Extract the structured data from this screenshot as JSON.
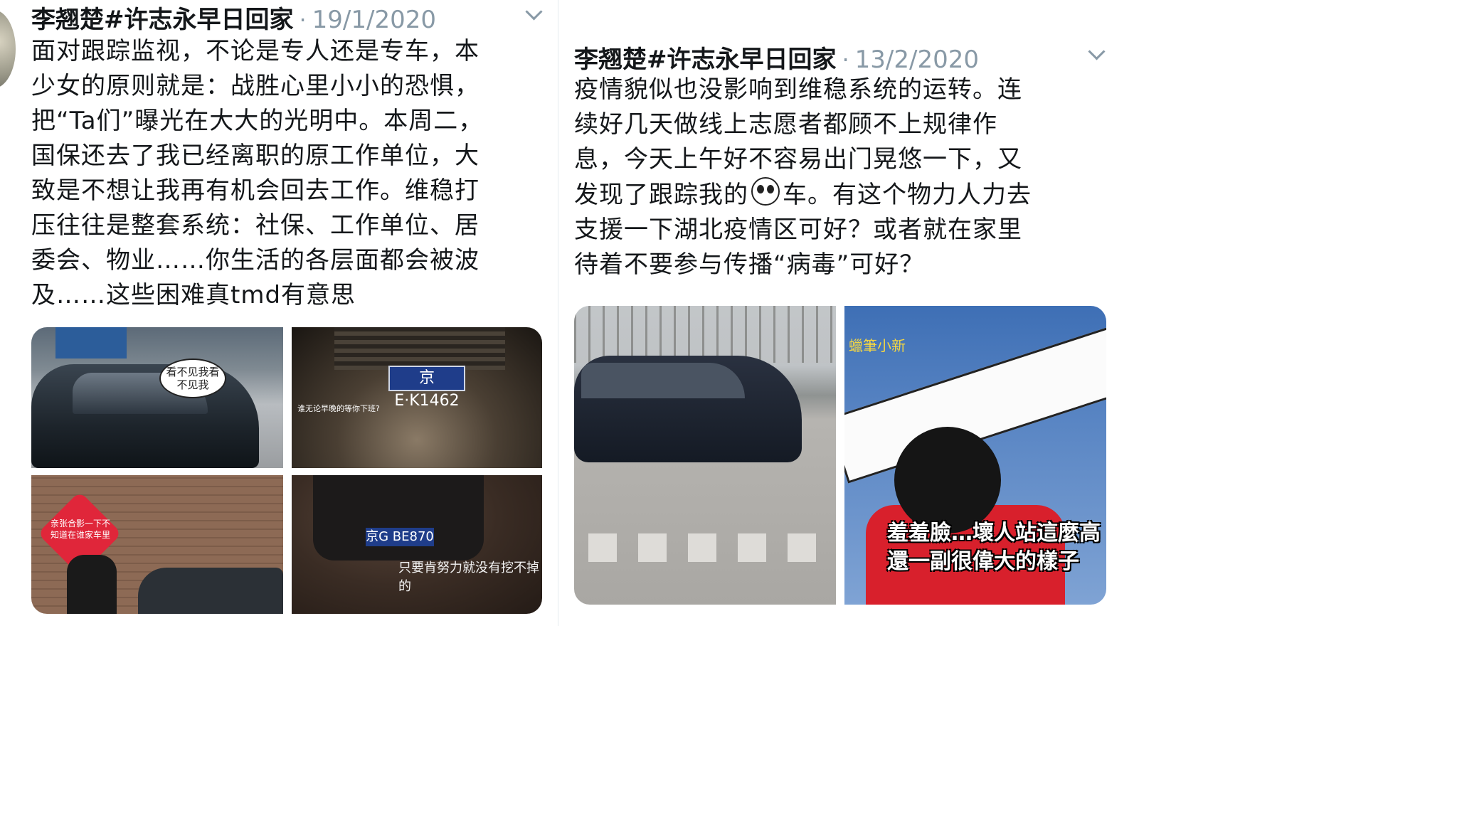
{
  "tweets": [
    {
      "name": "李翘楚#许志永早日回家",
      "separator": "·",
      "date": "19/1/2020",
      "text_lines": [
        "面对跟踪监视，不论是专人还是专车，本",
        "少女的原则就是：战胜心里小小的恐惧，",
        "把“Ta们”曝光在大大的光明中。本周二，",
        "国保还去了我已经离职的原工作单位，大",
        "致是不想让我再有机会回去工作。维稳打",
        "压往往是整套系统：社保、工作单位、居",
        "委会、物业……你生活的各层面都会被波",
        "及……这些困难真tmd有意思"
      ],
      "photos": {
        "p1_bubble": "看不见我看不见我",
        "p2_plate": "京E·K1462",
        "p2_caption": "谁无论早晚的等你下班?",
        "p3_heart": "亲张合影一下不知道在谁家车里",
        "p4_plate": "京G BE870",
        "p4_caption": "只要肯努力就没有挖不掉的"
      }
    },
    {
      "name": "李翘楚#许志永早日回家",
      "separator": "·",
      "date": "13/2/2020",
      "text_lines": [
        "疫情貌似也没影响到维稳系统的运转。连",
        "续好几天做线上志愿者都顾不上规律作",
        "息，今天上午好不容易出门晃悠一下，又",
        "发现了跟踪我的",
        "车。有这个物力人力去",
        "支援一下湖北疫情区可好？或者就在家里",
        "待着不要参与传播“病毒”可好？"
      ],
      "photos": {
        "p6_tag": "蠟筆小新",
        "p6_caption_line1": "羞羞臉…壞人站這麼高",
        "p6_caption_line2": "還一副很偉大的樣子"
      }
    }
  ],
  "icons": {
    "more": "chevron-down-icon",
    "emoji": "panda-icon"
  },
  "colors": {
    "muted": "#8899a6",
    "text": "#14171a"
  }
}
